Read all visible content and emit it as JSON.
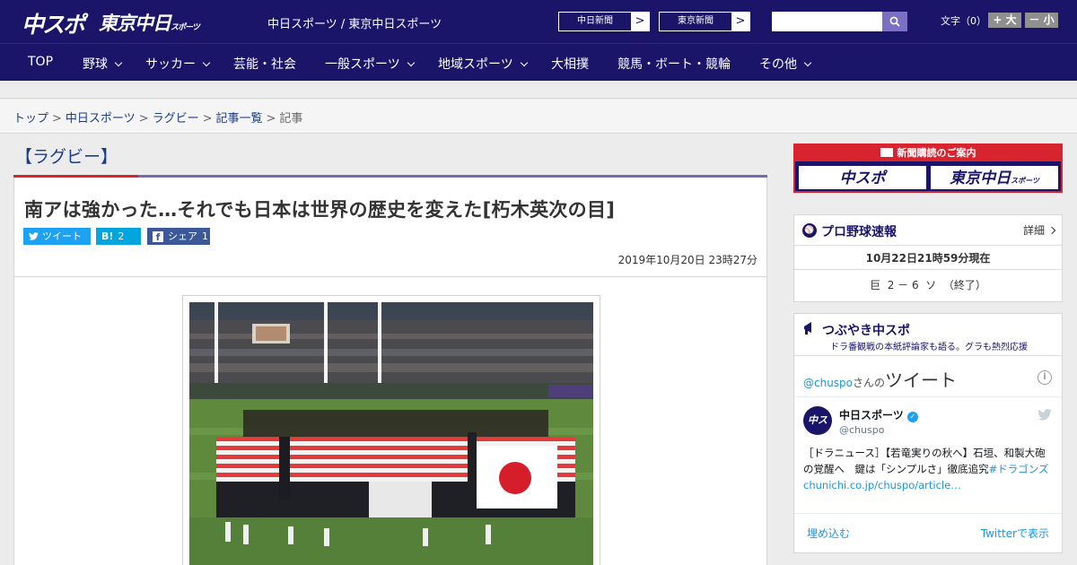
{
  "header": {
    "logo_chuspo": "中スポ",
    "logo_tokyo": "東京中日",
    "logo_tokyo_sub": "スポーツ",
    "site_name": "中日スポーツ / 東京中日スポーツ",
    "paper_links": [
      {
        "label": "中日新聞",
        "arrow": ">"
      },
      {
        "label": "東京新聞",
        "arrow": ">"
      }
    ],
    "search": {
      "placeholder": "",
      "icon": "search-icon"
    },
    "font_size_label": "文字（0）",
    "font_plus": "+ 大",
    "font_minus": "－ 小"
  },
  "nav": {
    "items": [
      {
        "label": "TOP",
        "dropdown": false
      },
      {
        "label": "野球",
        "dropdown": true
      },
      {
        "label": "サッカー",
        "dropdown": true
      },
      {
        "label": "芸能・社会",
        "dropdown": false
      },
      {
        "label": "一般スポーツ",
        "dropdown": true
      },
      {
        "label": "地域スポーツ",
        "dropdown": true
      },
      {
        "label": "大相撲",
        "dropdown": false
      },
      {
        "label": "競馬・ボート・競輪",
        "dropdown": false
      },
      {
        "label": "その他",
        "dropdown": true
      }
    ]
  },
  "breadcrumb": {
    "items": [
      "トップ",
      "中日スポーツ",
      "ラグビー",
      "記事一覧"
    ],
    "current": "記事",
    "separator": ">"
  },
  "article": {
    "category": "【ラグビー】",
    "title": "南アは強かった…それでも日本は世界の歴史を変えた[朽木英次の目]",
    "share": {
      "tweet_label": "ツイート",
      "hatena_label": "B!",
      "hatena_count": "2",
      "facebook_label": "シェア",
      "facebook_count": "1"
    },
    "date": "2019年10月20日 23時27分"
  },
  "sidebar": {
    "ad": {
      "heading": "新聞購読のご案内",
      "logo1": "中スポ",
      "logo2": "東京中日",
      "logo2_sub": "スポーツ"
    },
    "baseball": {
      "title": "プロ野球速報",
      "detail": "詳細",
      "timestamp": "10月22日21時59分現在",
      "score": "巨  2 － 6  ソ  （終了）"
    },
    "tweets": {
      "title": "つぶやき中スポ",
      "subtitle": "ドラ番観戦の本紙評論家も語る。グラも熱烈応援",
      "handle_prefix": "@chuspo",
      "handle_mid": "さんの",
      "header_title": "ツイート",
      "user_name": "中日スポーツ",
      "user_handle": "@chuspo",
      "avatar_text": "中スポ",
      "body_text": "［ドラニュース］【若竜実りの秋へ】石垣、和製大砲の覚醒へ　鍵は「シンプルさ」徹底追究",
      "body_link": "#ドラゴンズchunichi.co.jp/chuspo/article…",
      "embed_label": "埋め込む",
      "view_label": "Twitterで表示"
    }
  },
  "colors": {
    "navy": "#1a1569",
    "red": "#d8242f",
    "link": "#1a3c8c",
    "twitter": "#1da1f2",
    "hatena": "#00a4de",
    "facebook": "#3b5998"
  }
}
